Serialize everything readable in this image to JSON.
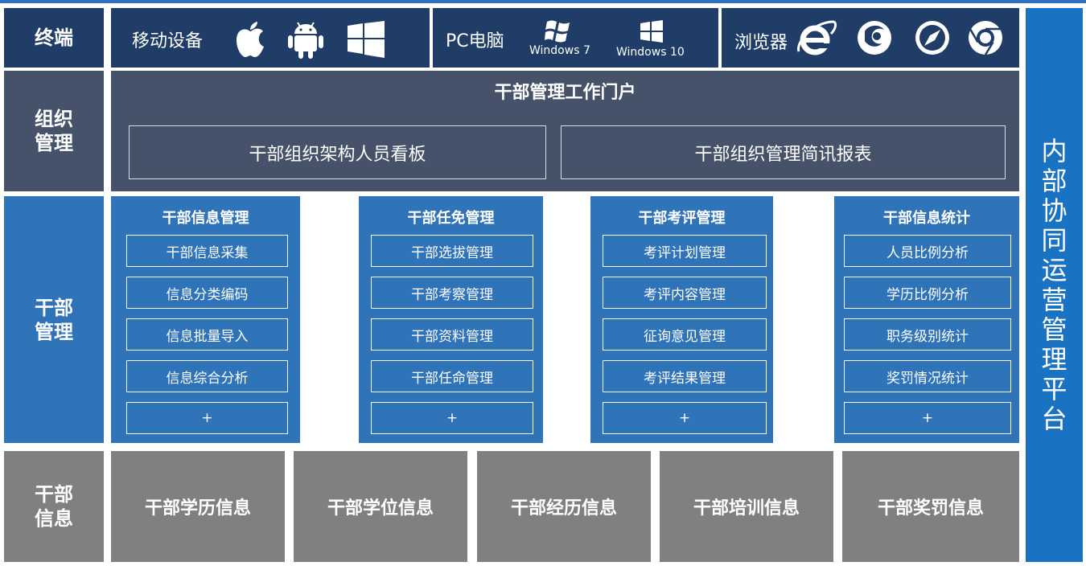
{
  "rows": {
    "terminal": "终端",
    "org_line1": "组织",
    "org_line2": "管理",
    "cadre_line1": "干部",
    "cadre_line2": "管理",
    "info_line1": "干部",
    "info_line2": "信息"
  },
  "platform_chars": [
    "内",
    "部",
    "协",
    "同",
    "运",
    "营",
    "管",
    "理",
    "平",
    "台"
  ],
  "devices": {
    "mobile": "移动设备",
    "pc": "PC电脑",
    "browser": "浏览器",
    "win7": "Windows 7",
    "win10": "Windows 10",
    "mobile_icons": [
      "apple-icon",
      "android-icon",
      "windows-icon"
    ],
    "browser_icons": [
      "ie-icon",
      "firefox-icon",
      "safari-icon",
      "chrome-icon"
    ]
  },
  "portal": {
    "title": "干部管理工作门户",
    "box1": "干部组织架构人员看板",
    "box2": "干部组织管理简讯报表"
  },
  "modules": [
    {
      "title": "干部信息管理",
      "items": [
        "干部信息采集",
        "信息分类编码",
        "信息批量导入",
        "信息综合分析",
        "+"
      ]
    },
    {
      "title": "干部任免管理",
      "items": [
        "干部选拔管理",
        "干部考察管理",
        "干部资料管理",
        "干部任命管理",
        "+"
      ]
    },
    {
      "title": "干部考评管理",
      "items": [
        "考评计划管理",
        "考评内容管理",
        "征询意见管理",
        "考评结果管理",
        "+"
      ]
    },
    {
      "title": "干部信息统计",
      "items": [
        "人员比例分析",
        "学历比例分析",
        "职务级别统计",
        "奖罚情况统计",
        "+"
      ]
    }
  ],
  "info_boxes": [
    "干部学历信息",
    "干部学位信息",
    "干部经历信息",
    "干部培训信息",
    "干部奖罚信息"
  ],
  "colors": {
    "navy": "#1f3d66",
    "slate": "#45526a",
    "blue": "#2f73b8",
    "gray": "#808080",
    "platform": "#1a73c2"
  }
}
